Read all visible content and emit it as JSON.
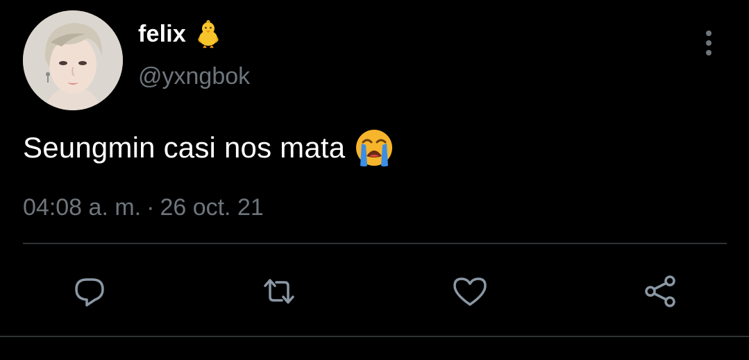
{
  "tweet": {
    "author": {
      "display_name": "felix",
      "name_emoji_icon": "baby-chick-icon",
      "handle": "@yxngbok",
      "avatar": "profile-photo"
    },
    "text": "Seungmin casi nos mata",
    "text_emoji_icon": "loudly-crying-face-icon",
    "timestamp": {
      "time": "04:08 a. m.",
      "separator": "·",
      "date": "26 oct. 21"
    },
    "menu_icon": "more-vertical-icon",
    "actions": [
      {
        "name": "reply",
        "icon": "reply-icon"
      },
      {
        "name": "retweet",
        "icon": "retweet-icon"
      },
      {
        "name": "like",
        "icon": "heart-icon"
      },
      {
        "name": "share",
        "icon": "share-icon"
      }
    ]
  },
  "colors": {
    "background": "#000000",
    "primary_text": "#ffffff",
    "secondary_text": "#6e767d",
    "divider": "#2f3336"
  }
}
